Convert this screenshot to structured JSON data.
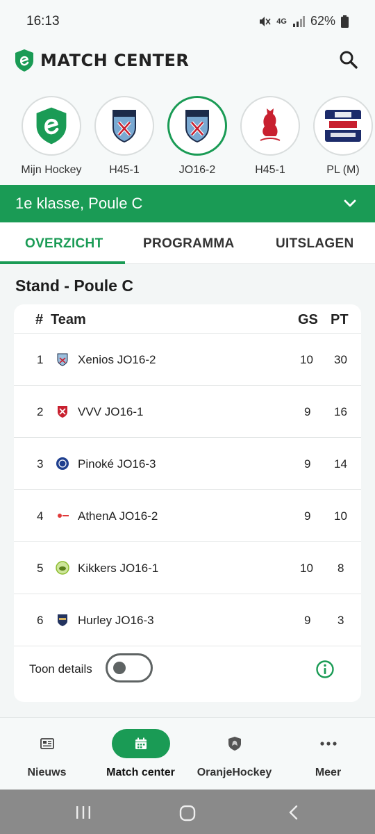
{
  "status": {
    "time": "16:13",
    "network": "4G",
    "battery": "62%"
  },
  "app": {
    "title": "MATCH CENTER"
  },
  "teams": [
    {
      "label": "Mijn Hockey",
      "icon": "mijn-hockey-logo"
    },
    {
      "label": "H45-1",
      "icon": "xenios-crest"
    },
    {
      "label": "JO16-2",
      "icon": "xenios-crest",
      "selected": true
    },
    {
      "label": "H45-1",
      "icon": "liberty-fox-logo"
    },
    {
      "label": "PL (M)",
      "icon": "fih-pro-league-logo"
    }
  ],
  "league": {
    "name": "1e klasse, Poule C"
  },
  "tabs": [
    {
      "label": "OVERZICHT",
      "active": true
    },
    {
      "label": "PROGRAMMA"
    },
    {
      "label": "UITSLAGEN"
    }
  ],
  "standings": {
    "title": "Stand - Poule C",
    "headers": {
      "rank": "#",
      "team": "Team",
      "gs": "GS",
      "pt": "PT"
    },
    "rows": [
      {
        "rank": "1",
        "team": "Xenios JO16-2",
        "gs": "10",
        "pt": "30",
        "color": "#6f9fc8"
      },
      {
        "rank": "2",
        "team": "VVV JO16-1",
        "gs": "9",
        "pt": "16",
        "color": "#c8202f"
      },
      {
        "rank": "3",
        "team": "Pinoké JO16-3",
        "gs": "9",
        "pt": "14",
        "color": "#1f3f8f"
      },
      {
        "rank": "4",
        "team": "AthenA JO16-2",
        "gs": "9",
        "pt": "10",
        "color": "#e03a3a"
      },
      {
        "rank": "5",
        "team": "Kikkers JO16-1",
        "gs": "10",
        "pt": "8",
        "color": "#8cbd2e"
      },
      {
        "rank": "6",
        "team": "Hurley JO16-3",
        "gs": "9",
        "pt": "3",
        "color": "#23335f"
      }
    ],
    "details_label": "Toon details"
  },
  "bottom_nav": [
    {
      "label": "Nieuws",
      "icon": "news-icon"
    },
    {
      "label": "Match center",
      "icon": "calendar-icon",
      "active": true
    },
    {
      "label": "OranjeHockey",
      "icon": "oranje-hockey-icon"
    },
    {
      "label": "Meer",
      "icon": "more-icon"
    }
  ],
  "colors": {
    "primary": "#1a9b55",
    "background": "#f3f6f6"
  }
}
